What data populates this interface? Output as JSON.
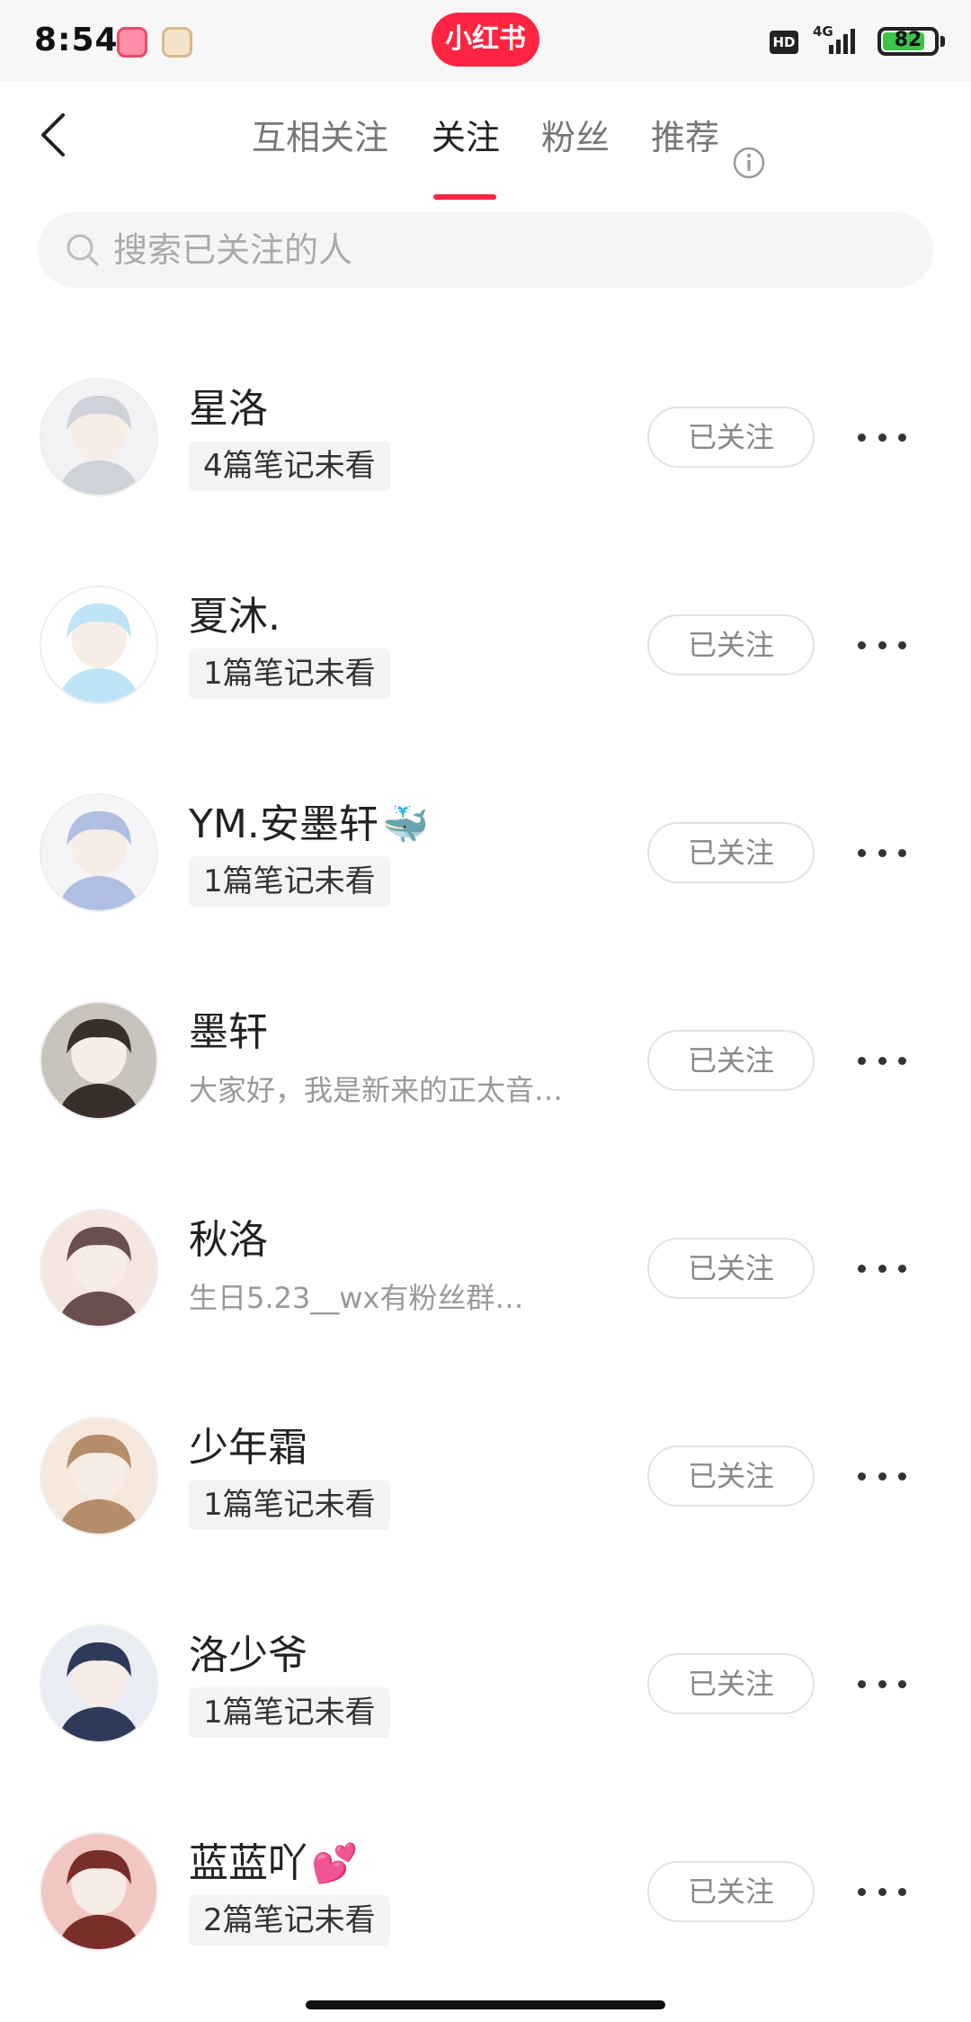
{
  "status_bar": {
    "time": "8:54",
    "brand": "小红书",
    "hd": "HD",
    "network": "4G",
    "battery": "82",
    "battery_level": 0.82,
    "brand_color": "#ff2442"
  },
  "header": {
    "tabs": [
      {
        "label": "互相关注",
        "active": false
      },
      {
        "label": "关注",
        "active": true
      },
      {
        "label": "粉丝",
        "active": false
      },
      {
        "label": "推荐",
        "active": false
      }
    ],
    "accent_color": "#ff2442"
  },
  "search": {
    "value": "",
    "placeholder": "搜索已关注的人"
  },
  "users": [
    {
      "name": "星洛",
      "emoji": "",
      "badge": "4篇笔记未看",
      "subtitle": "",
      "button": "已关注",
      "avatar_colors": [
        "#cfd2d8",
        "#f2f2f4"
      ]
    },
    {
      "name": "夏沐.",
      "emoji": "",
      "badge": "1篇笔记未看",
      "subtitle": "",
      "button": "已关注",
      "avatar_colors": [
        "#bfe3f7",
        "#ffffff"
      ]
    },
    {
      "name": "YM.安墨轩",
      "emoji": "🐳",
      "badge": "1篇笔记未看",
      "subtitle": "",
      "button": "已关注",
      "avatar_colors": [
        "#aebfe3",
        "#f5f5f7"
      ]
    },
    {
      "name": "墨轩",
      "emoji": "",
      "badge": "",
      "subtitle": "大家好，我是新来的正太音…",
      "button": "已关注",
      "avatar_colors": [
        "#3a2e2b",
        "#c9c3be"
      ]
    },
    {
      "name": "秋洛",
      "emoji": "",
      "badge": "",
      "subtitle": "生日5.23__wx有粉丝群…",
      "button": "已关注",
      "avatar_colors": [
        "#6b4f4f",
        "#f5e6e0"
      ]
    },
    {
      "name": "少年霜",
      "emoji": "",
      "badge": "1篇笔记未看",
      "subtitle": "",
      "button": "已关注",
      "avatar_colors": [
        "#b58d6a",
        "#f7e8de"
      ]
    },
    {
      "name": "洛少爷",
      "emoji": "",
      "badge": "1篇笔记未看",
      "subtitle": "",
      "button": "已关注",
      "avatar_colors": [
        "#2f3a5a",
        "#e9eef5"
      ]
    },
    {
      "name": "蓝蓝吖",
      "emoji": "💕",
      "badge": "2篇笔记未看",
      "subtitle": "",
      "button": "已关注",
      "avatar_colors": [
        "#7a2e2a",
        "#f2c7c1"
      ]
    }
  ]
}
